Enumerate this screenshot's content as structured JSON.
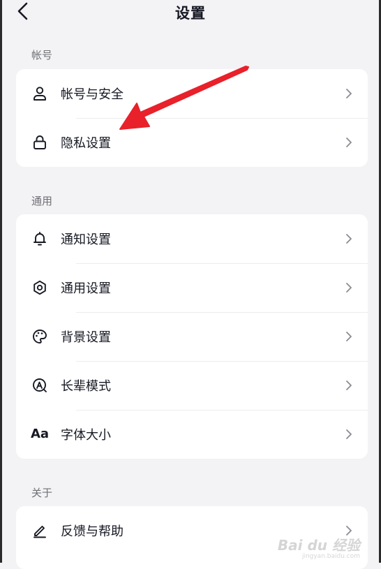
{
  "header": {
    "title": "设置"
  },
  "sections": {
    "account": {
      "label": "帐号",
      "items": [
        {
          "label": "帐号与安全",
          "icon": "person-icon"
        },
        {
          "label": "隐私设置",
          "icon": "lock-icon"
        }
      ]
    },
    "general": {
      "label": "通用",
      "items": [
        {
          "label": "通知设置",
          "icon": "bell-icon"
        },
        {
          "label": "通用设置",
          "icon": "gear-icon"
        },
        {
          "label": "背景设置",
          "icon": "palette-icon"
        },
        {
          "label": "长辈模式",
          "icon": "elder-mode-icon"
        },
        {
          "label": "字体大小",
          "icon": "font-size-icon",
          "glyph": "Aa"
        }
      ]
    },
    "about": {
      "label": "关于",
      "items": [
        {
          "label": "反馈与帮助",
          "icon": "pencil-icon"
        }
      ]
    }
  },
  "annotation": {
    "color": "#e8212b",
    "target": "隐私设置"
  },
  "watermark": {
    "main": "Bai du 经验",
    "sub": "jingyan.baidu.com"
  }
}
